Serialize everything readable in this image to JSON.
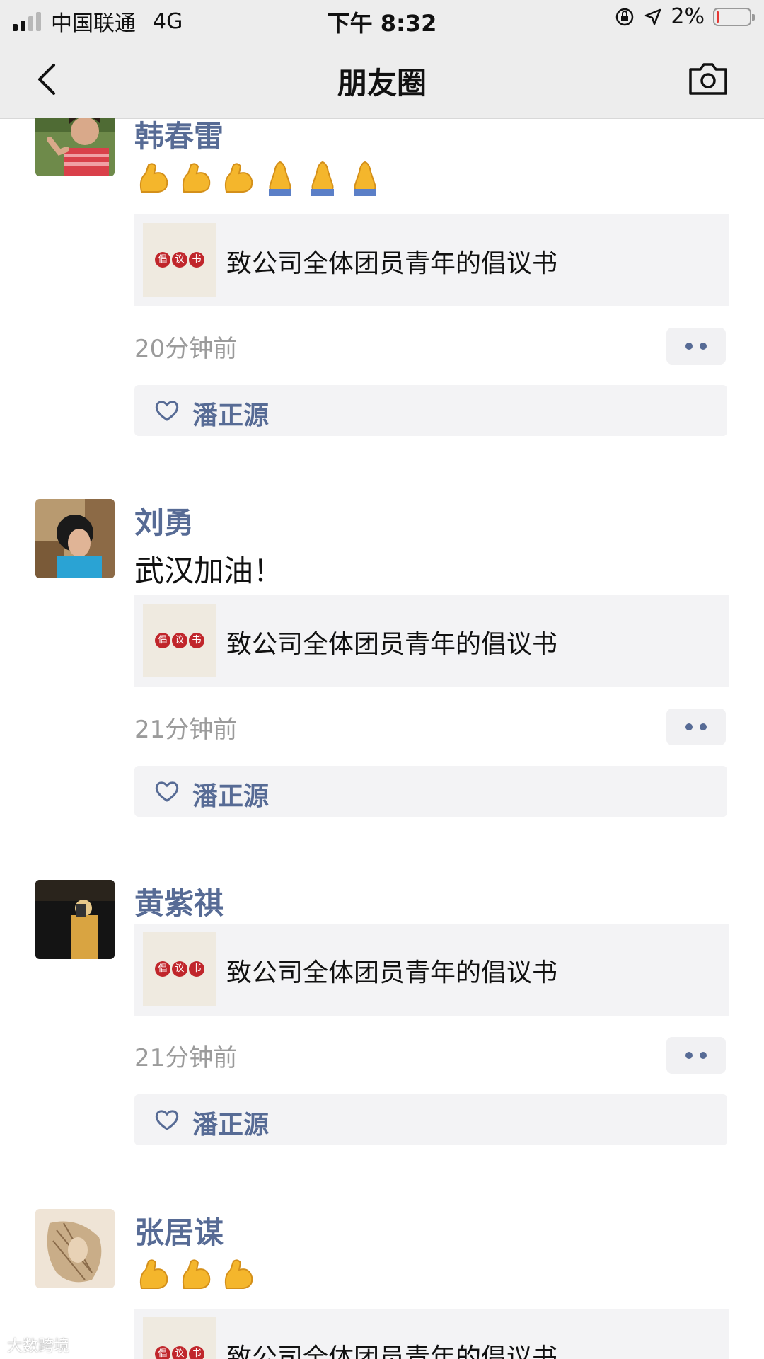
{
  "status_bar": {
    "carrier": "中国联通",
    "network": "4G",
    "time": "下午 8:32",
    "battery_percent": "2%"
  },
  "nav": {
    "title": "朋友圈"
  },
  "posts": [
    {
      "name": "韩春雷",
      "text": "",
      "emojis": [
        "💪",
        "💪",
        "💪",
        "🙏",
        "🙏",
        "🙏"
      ],
      "link_title": "致公司全体团员青年的倡议书",
      "time": "20分钟前",
      "likes": "潘正源"
    },
    {
      "name": "刘勇",
      "text": "武汉加油！",
      "emojis": [],
      "link_title": "致公司全体团员青年的倡议书",
      "time": "21分钟前",
      "likes": "潘正源"
    },
    {
      "name": "黄紫祺",
      "text": "",
      "emojis": [],
      "link_title": "致公司全体团员青年的倡议书",
      "time": "21分钟前",
      "likes": "潘正源"
    },
    {
      "name": "张居谋",
      "text": "",
      "emojis": [
        "💪",
        "💪",
        "💪"
      ],
      "link_title": "致公司全体团员青年的倡议书",
      "time": "",
      "likes": ""
    }
  ],
  "link_thumb_seal": [
    "倡",
    "议",
    "书"
  ],
  "watermark": "大数跨境",
  "colors": {
    "name_link": "#576b95",
    "bar_bg": "#ededed",
    "card_bg": "#f3f3f5",
    "time_gray": "#9b9b9b"
  }
}
